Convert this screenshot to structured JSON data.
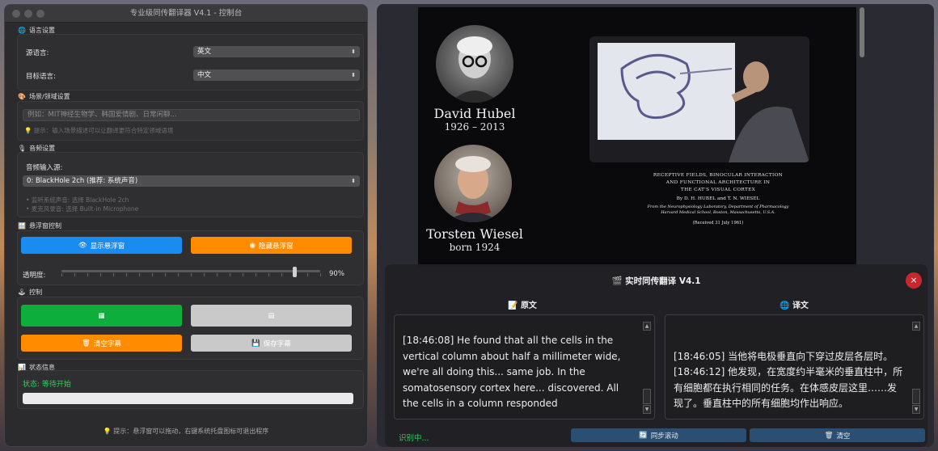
{
  "control": {
    "title": "专业级同传翻译器 V4.1 - 控制台",
    "language": {
      "header": "语言设置",
      "source_label": "源语言:",
      "source_value": "英文",
      "target_label": "目标语言:",
      "target_value": "中文"
    },
    "scene": {
      "header": "场景/领域设置",
      "placeholder": "例如：MIT神经生物学、韩国爱情剧、日常闲聊...",
      "hint": "提示：输入场景描述可以让翻译更符合特定领域语境"
    },
    "audio": {
      "header": "音频设置",
      "input_label": "音频输入源:",
      "input_value": "0: BlackHole 2ch (推荐: 系统声音)",
      "hint1": "• 监听系统声音: 选择 BlackHole 2ch",
      "hint2": "• 麦克风录音: 选择 Built-in Microphone"
    },
    "floating": {
      "header": "悬浮窗控制",
      "show_label": "显示悬浮窗",
      "hide_label": "隐藏悬浮窗",
      "opacity_label": "透明度:",
      "opacity_value": "90%",
      "opacity": 0.9
    },
    "controls": {
      "header": "控制",
      "clear_label": "清空字幕",
      "save_label": "保存字幕"
    },
    "status": {
      "header": "状态信息",
      "text": "状态: 等待开始"
    },
    "footer_hint": "提示：悬浮窗可以拖动，右键系统托盘图标可退出程序"
  },
  "video": {
    "person1_name": "David Hubel",
    "person1_years": "1926 – 2013",
    "person2_name": "Torsten Wiesel",
    "person2_years": "born 1924",
    "paper_title1": "RECEPTIVE FIELDS, BINOCULAR INTERACTION",
    "paper_title2": "AND FUNCTIONAL ARCHITECTURE IN",
    "paper_title3": "THE CAT'S VISUAL CORTEX",
    "paper_authors": "By D. H. HUBEL and T. N. WIESEL",
    "paper_affil1": "From the Neurophysiology Laboratory, Department of Pharmacology",
    "paper_affil2": "Harvard Medical School, Boston, Massachusetts, U.S.A.",
    "paper_received": "(Received 31 July 1961)"
  },
  "translator": {
    "title": "实时同传翻译 V4.1",
    "original_header": "原文",
    "translation_header": "译文",
    "original_text": "[18:46:08] He found that all the cells in the vertical column about half a millimeter wide, we're all doing this... same job.  In the somatosensory cortex here... discovered.  All the cells in a column responded",
    "translation_text": "[18:46:05] 当他将电极垂直向下穿过皮层各层时。\n[18:46:12] 他发现，在宽度约半毫米的垂直柱中，所有细胞都在执行相同的任务。在体感皮层这里……发现了。垂直柱中的所有细胞均作出响应。",
    "status": "识别中...",
    "sync_label": "同步滚动",
    "clear_label": "清空"
  },
  "colors": {
    "blue": "#1a8cf0",
    "orange": "#ff8c00",
    "green": "#0dae3c",
    "gray": "#c9c9c9",
    "status_green": "#2fcf5c",
    "close_red": "#c8282d"
  }
}
